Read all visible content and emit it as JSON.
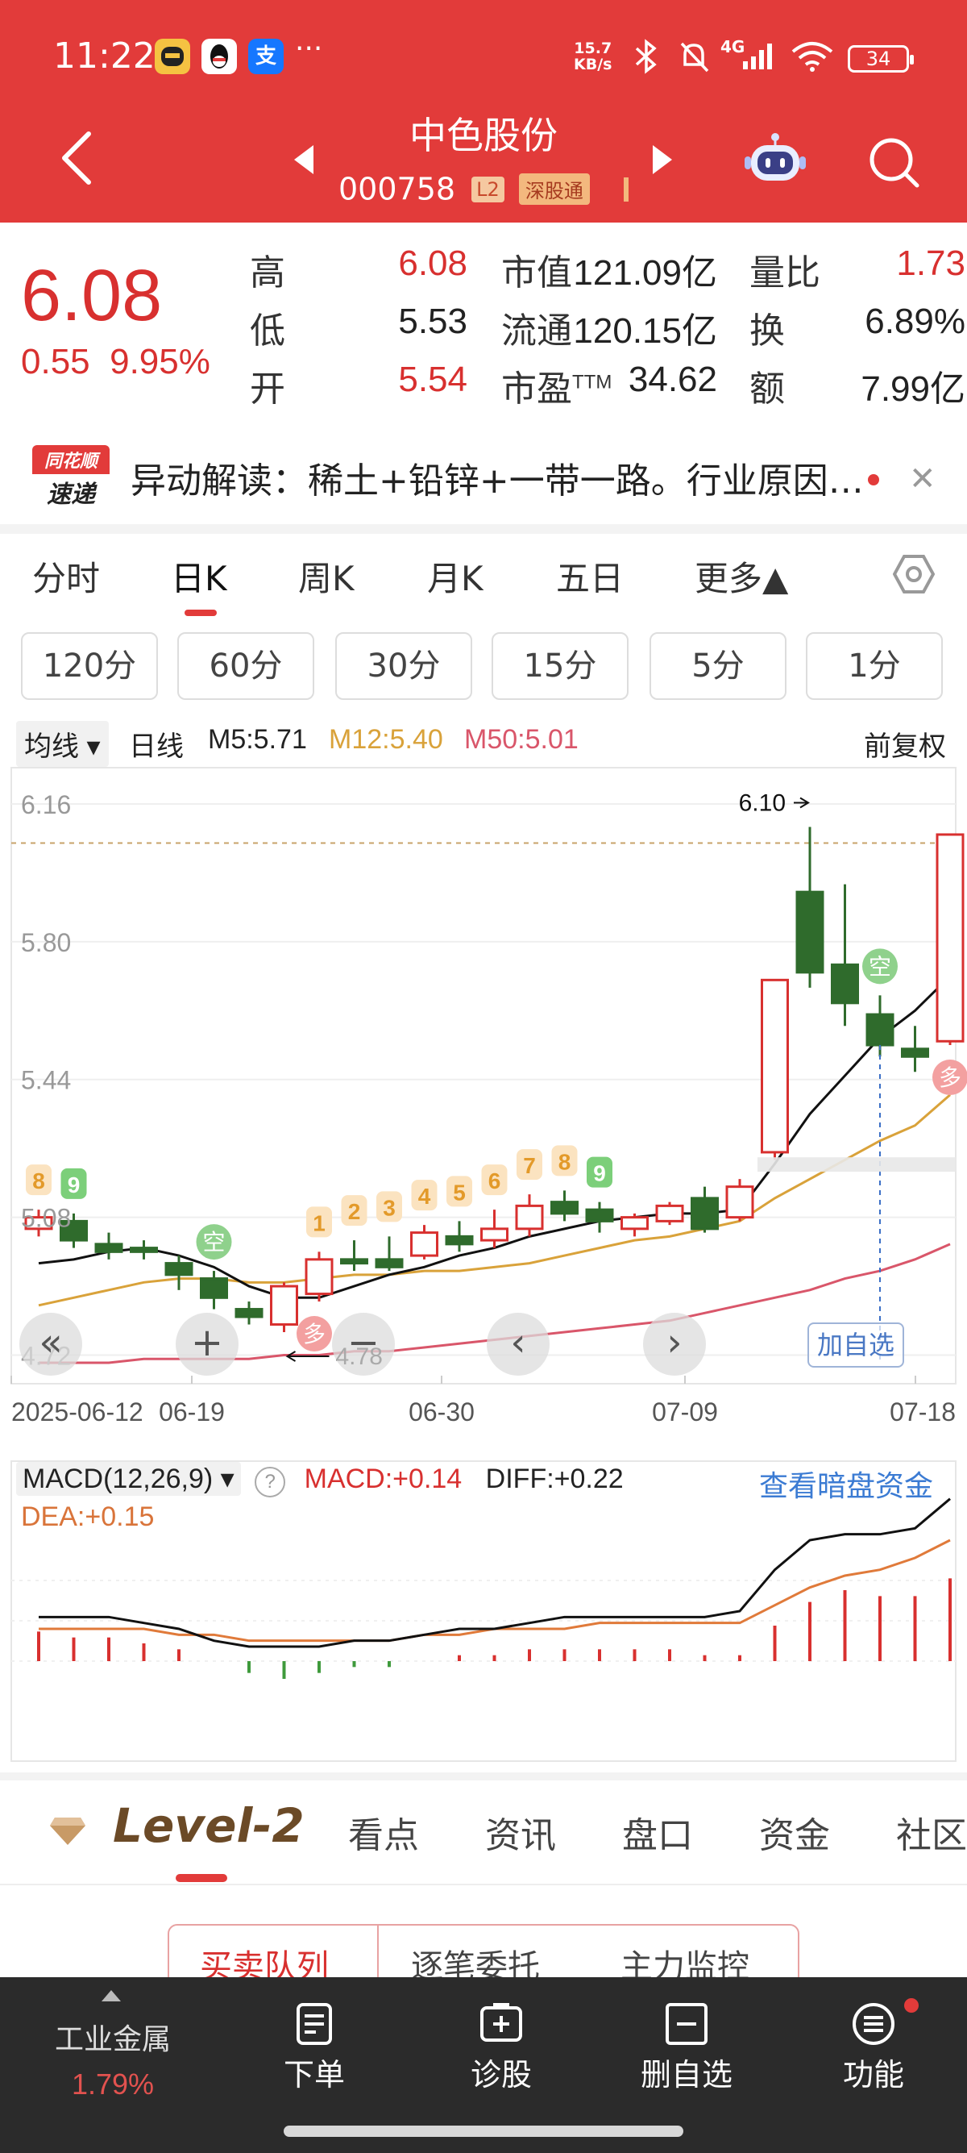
{
  "status_bar": {
    "time": "11:22",
    "more": "···",
    "speed_top": "15.7",
    "speed_bottom": "KB/s",
    "network": "4G",
    "battery": "34"
  },
  "header": {
    "stock_name": "中色股份",
    "stock_code": "000758",
    "badge_l2": "L2",
    "badge_connect": "深股通"
  },
  "quote": {
    "price": "6.08",
    "change": "0.55",
    "change_pct": "9.95%",
    "rows": [
      {
        "label": "高",
        "value": "6.08",
        "label2": "市值",
        "value2": "121.09亿",
        "label3": "量比",
        "value3": "1.73"
      },
      {
        "label": "低",
        "value": "5.53",
        "label2": "流通",
        "value2": "120.15亿",
        "label3": "换",
        "value3": "6.89%"
      },
      {
        "label": "开",
        "value": "5.54",
        "label2": "市盈TTM",
        "value2": "34.62",
        "label3": "额",
        "value3": "7.99亿"
      }
    ],
    "pe_label_main": "市盈",
    "pe_label_sup": "TTM"
  },
  "news": {
    "logo_top": "同花顺",
    "logo_bottom": "速递",
    "text": "异动解读：稀土+铅锌+一带一路。行业原因…"
  },
  "period_tabs": [
    "分时",
    "日K",
    "周K",
    "月K",
    "五日",
    "更多▲"
  ],
  "minute_buttons": [
    "120分",
    "60分",
    "30分",
    "15分",
    "5分",
    "1分"
  ],
  "ma_legend": {
    "select": "均线",
    "line_type": "日线",
    "m5": "M5:5.71",
    "m12": "M12:5.40",
    "m50": "M50:5.01",
    "adjust": "前复权"
  },
  "chart_data": {
    "type": "candlestick",
    "y_ticks": [
      "6.16",
      "5.80",
      "5.44",
      "5.08",
      "4.72"
    ],
    "x_ticks": [
      "2025-06-12",
      "06-19",
      "06-30",
      "07-09",
      "07-18"
    ],
    "high_marker": "6.10",
    "low_marker": "4.78",
    "candles": [
      {
        "o": 5.05,
        "c": 5.08,
        "h": 5.1,
        "l": 5.03,
        "up": true
      },
      {
        "o": 5.07,
        "c": 5.02,
        "h": 5.09,
        "l": 5.0,
        "up": false
      },
      {
        "o": 5.01,
        "c": 4.99,
        "h": 5.04,
        "l": 4.97,
        "up": false
      },
      {
        "o": 5.0,
        "c": 4.99,
        "h": 5.02,
        "l": 4.97,
        "up": false
      },
      {
        "o": 4.96,
        "c": 4.93,
        "h": 4.98,
        "l": 4.89,
        "up": false
      },
      {
        "o": 4.92,
        "c": 4.87,
        "h": 4.94,
        "l": 4.84,
        "up": false
      },
      {
        "o": 4.84,
        "c": 4.82,
        "h": 4.86,
        "l": 4.8,
        "up": false
      },
      {
        "o": 4.8,
        "c": 4.9,
        "h": 4.91,
        "l": 4.78,
        "up": true
      },
      {
        "o": 4.88,
        "c": 4.97,
        "h": 4.99,
        "l": 4.86,
        "up": true
      },
      {
        "o": 4.97,
        "c": 4.96,
        "h": 5.02,
        "l": 4.94,
        "up": false
      },
      {
        "o": 4.97,
        "c": 4.95,
        "h": 5.03,
        "l": 4.94,
        "up": false
      },
      {
        "o": 4.98,
        "c": 5.04,
        "h": 5.06,
        "l": 4.97,
        "up": true
      },
      {
        "o": 5.03,
        "c": 5.01,
        "h": 5.07,
        "l": 4.99,
        "up": false
      },
      {
        "o": 5.02,
        "c": 5.05,
        "h": 5.1,
        "l": 5.0,
        "up": true
      },
      {
        "o": 5.05,
        "c": 5.11,
        "h": 5.14,
        "l": 5.03,
        "up": true
      },
      {
        "o": 5.12,
        "c": 5.09,
        "h": 5.15,
        "l": 5.07,
        "up": false
      },
      {
        "o": 5.1,
        "c": 5.07,
        "h": 5.12,
        "l": 5.04,
        "up": false
      },
      {
        "o": 5.05,
        "c": 5.08,
        "h": 5.09,
        "l": 5.03,
        "up": true
      },
      {
        "o": 5.07,
        "c": 5.11,
        "h": 5.12,
        "l": 5.06,
        "up": true
      },
      {
        "o": 5.13,
        "c": 5.05,
        "h": 5.16,
        "l": 5.04,
        "up": false
      },
      {
        "o": 5.08,
        "c": 5.16,
        "h": 5.18,
        "l": 5.07,
        "up": true
      },
      {
        "o": 5.25,
        "c": 5.7,
        "h": 5.7,
        "l": 5.23,
        "up": true
      },
      {
        "o": 5.93,
        "c": 5.72,
        "h": 6.1,
        "l": 5.68,
        "up": false
      },
      {
        "o": 5.74,
        "c": 5.64,
        "h": 5.95,
        "l": 5.58,
        "up": false
      },
      {
        "o": 5.61,
        "c": 5.53,
        "h": 5.66,
        "l": 5.5,
        "up": false
      },
      {
        "o": 5.52,
        "c": 5.5,
        "h": 5.58,
        "l": 5.46,
        "up": false
      },
      {
        "o": 5.54,
        "c": 6.08,
        "h": 6.08,
        "l": 5.53,
        "up": true
      }
    ],
    "m5": [
      4.96,
      4.97,
      4.99,
      5.0,
      4.98,
      4.95,
      4.9,
      4.87,
      4.87,
      4.9,
      4.93,
      4.95,
      4.98,
      5.0,
      5.03,
      5.05,
      5.07,
      5.08,
      5.09,
      5.09,
      5.1,
      5.22,
      5.35,
      5.45,
      5.55,
      5.62,
      5.71
    ],
    "m12": [
      4.85,
      4.87,
      4.89,
      4.91,
      4.92,
      4.92,
      4.91,
      4.91,
      4.92,
      4.93,
      4.93,
      4.94,
      4.94,
      4.95,
      4.96,
      4.98,
      5.0,
      5.02,
      5.03,
      5.05,
      5.07,
      5.13,
      5.18,
      5.23,
      5.28,
      5.32,
      5.4
    ],
    "m50": [
      4.7,
      4.7,
      4.7,
      4.71,
      4.71,
      4.71,
      4.71,
      4.72,
      4.72,
      4.73,
      4.73,
      4.74,
      4.75,
      4.76,
      4.77,
      4.78,
      4.79,
      4.8,
      4.81,
      4.83,
      4.85,
      4.87,
      4.89,
      4.92,
      4.94,
      4.97,
      5.01
    ],
    "signals": [
      {
        "index": 0,
        "text": "8",
        "kind": "count"
      },
      {
        "index": 1,
        "text": "9",
        "kind": "green"
      },
      {
        "index": 8,
        "text": "1",
        "kind": "count"
      },
      {
        "index": 9,
        "text": "2",
        "kind": "count"
      },
      {
        "index": 10,
        "text": "3",
        "kind": "count"
      },
      {
        "index": 11,
        "text": "4",
        "kind": "count"
      },
      {
        "index": 12,
        "text": "5",
        "kind": "count"
      },
      {
        "index": 13,
        "text": "6",
        "kind": "count"
      },
      {
        "index": 14,
        "text": "7",
        "kind": "count"
      },
      {
        "index": 15,
        "text": "8",
        "kind": "count"
      },
      {
        "index": 16,
        "text": "9",
        "kind": "green"
      }
    ],
    "markers": [
      {
        "index": 5,
        "text": "空",
        "kind": "short"
      },
      {
        "index": 8,
        "text": "多",
        "kind": "long"
      },
      {
        "index": 24,
        "text": "空",
        "kind": "short"
      },
      {
        "index": 26,
        "text": "多",
        "kind": "long"
      }
    ]
  },
  "chart_buttons": {
    "collapse": "«",
    "zoom_in": "+",
    "zoom_out": "−",
    "prev": "‹",
    "next": "›",
    "add_watch": "加自选"
  },
  "macd": {
    "select": "MACD(12,26,9)",
    "info": "?",
    "macd_value": "MACD:+0.14",
    "diff_value": "DIFF:+0.22",
    "dea_value": "DEA:+0.15",
    "link": "查看暗盘资金",
    "bars": [
      0.05,
      0.04,
      0.04,
      0.03,
      0.02,
      0.0,
      -0.02,
      -0.03,
      -0.02,
      -0.01,
      -0.01,
      0.0,
      0.01,
      0.01,
      0.02,
      0.02,
      0.02,
      0.02,
      0.02,
      0.01,
      0.01,
      0.06,
      0.1,
      0.12,
      0.11,
      0.11,
      0.14
    ],
    "diff": [
      0.02,
      0.02,
      0.02,
      0.01,
      0.0,
      -0.02,
      -0.03,
      -0.03,
      -0.03,
      -0.02,
      -0.02,
      -0.01,
      0.0,
      0.0,
      0.01,
      0.02,
      0.02,
      0.02,
      0.02,
      0.02,
      0.03,
      0.1,
      0.15,
      0.16,
      0.16,
      0.17,
      0.22
    ],
    "dea": [
      0.0,
      0.0,
      0.0,
      0.0,
      -0.01,
      -0.01,
      -0.02,
      -0.02,
      -0.02,
      -0.02,
      -0.02,
      -0.01,
      -0.01,
      0.0,
      0.0,
      0.0,
      0.01,
      0.01,
      0.01,
      0.01,
      0.01,
      0.04,
      0.07,
      0.09,
      0.1,
      0.12,
      0.15
    ]
  },
  "level2": {
    "logo": "Level-2",
    "tabs": [
      "看点",
      "资讯",
      "盘口",
      "资金",
      "社区"
    ],
    "queue_tabs": [
      "买卖队列",
      "逐笔委托",
      "主力监控"
    ]
  },
  "bottom_nav": {
    "sector_name": "工业金属",
    "sector_pct": "1.79%",
    "items": [
      "下单",
      "诊股",
      "删自选",
      "功能"
    ]
  },
  "colors": {
    "brand_red": "#e23b3a",
    "up_red": "#d8302f",
    "down_green": "#2f6b2c",
    "m5": "#111111",
    "m12": "#d9a23a",
    "m50": "#d9566a"
  }
}
